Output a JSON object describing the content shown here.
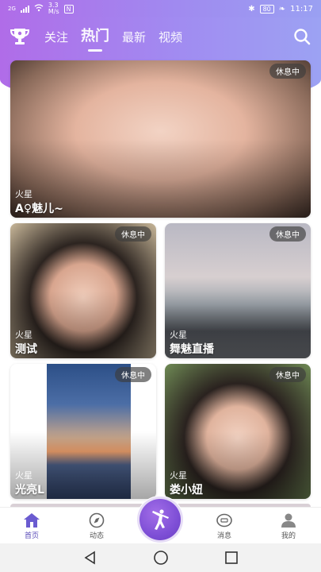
{
  "status": {
    "network": "2G",
    "speed_value": "3.3",
    "speed_unit": "M/s",
    "battery": "80",
    "time": "11:17"
  },
  "header": {
    "tabs": [
      {
        "label": "关注",
        "active": false
      },
      {
        "label": "热门",
        "active": true
      },
      {
        "label": "最新",
        "active": false
      },
      {
        "label": "视频",
        "active": false
      }
    ]
  },
  "cards": [
    {
      "status": "休息中",
      "location": "火星",
      "name": "A♀魅儿~"
    },
    {
      "status": "休息中",
      "location": "火星",
      "name": "测试"
    },
    {
      "status": "休息中",
      "location": "火星",
      "name": "舞魅直播"
    },
    {
      "status": "休息中",
      "location": "火星",
      "name": "光亮L"
    },
    {
      "status": "休息中",
      "location": "火星",
      "name": "娄小妞"
    }
  ],
  "bottom_nav": {
    "items": [
      {
        "label": "首页",
        "icon": "home-icon",
        "active": true
      },
      {
        "label": "动态",
        "icon": "compass-icon",
        "active": false
      },
      {
        "label": "消息",
        "icon": "message-icon",
        "active": false
      },
      {
        "label": "我的",
        "icon": "profile-icon",
        "active": false
      }
    ]
  },
  "colors": {
    "brand_gradient_start": "#b06ce8",
    "brand_gradient_end": "#9ca2f3",
    "fab": "#7e4fd6",
    "nav_active": "#5a4bb8"
  }
}
